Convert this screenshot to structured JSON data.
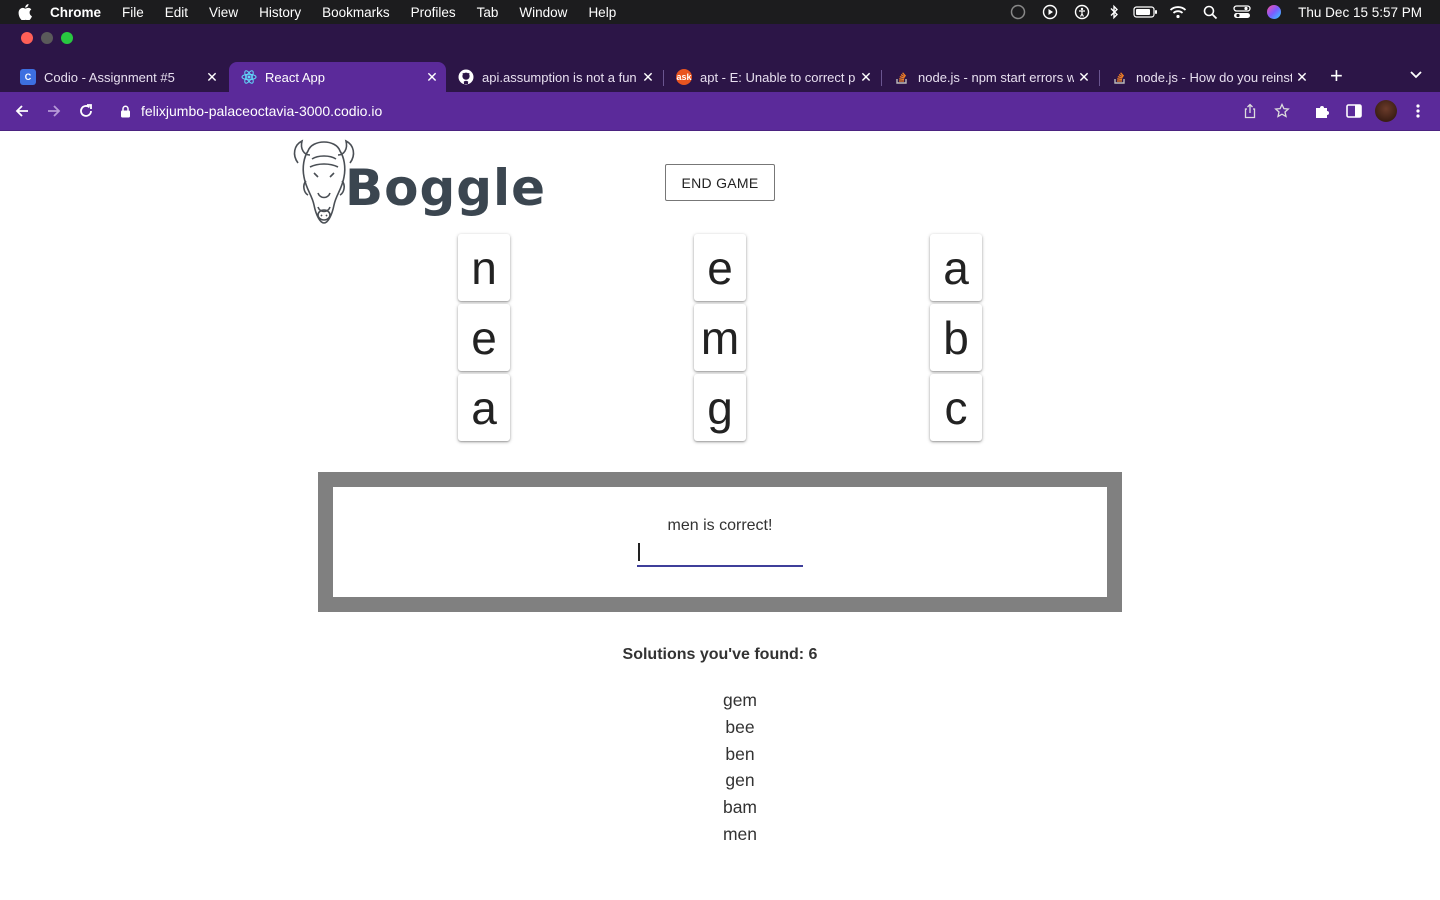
{
  "menubar": {
    "app": "Chrome",
    "items": [
      "File",
      "Edit",
      "View",
      "History",
      "Bookmarks",
      "Profiles",
      "Tab",
      "Window",
      "Help"
    ],
    "clock": "Thu Dec 15  5:57 PM"
  },
  "tabs": [
    {
      "title": "Codio - Assignment #5",
      "favicon": "codio-icon",
      "active": false
    },
    {
      "title": "React App",
      "favicon": "react-icon",
      "active": true
    },
    {
      "title": "api.assumption is not a fun",
      "favicon": "github-icon",
      "active": false
    },
    {
      "title": "apt - E: Unable to correct p",
      "favicon": "askubuntu-icon",
      "active": false
    },
    {
      "title": "node.js - npm start errors w",
      "favicon": "stackoverflow-icon",
      "active": false
    },
    {
      "title": "node.js - How do you reinst",
      "favicon": "stackoverflow-icon",
      "active": false
    }
  ],
  "address": {
    "url": "felixjumbo-palaceoctavia-3000.codio.io"
  },
  "colors": {
    "tabstrip": "#2c1547",
    "toolbar": "#5b2a9a",
    "frame": "#808080",
    "input_underline": "#3f3f9a"
  },
  "game": {
    "logo_text": "Boggle",
    "end_button": "END GAME",
    "grid": [
      [
        "n",
        "e",
        "a"
      ],
      [
        "e",
        "m",
        "b"
      ],
      [
        "a",
        "g",
        "c"
      ]
    ],
    "feedback": "men is correct!",
    "input_value": "",
    "found_label": "Solutions you've found: 6",
    "solutions": [
      "gem",
      "bee",
      "ben",
      "gen",
      "bam",
      "men"
    ]
  }
}
